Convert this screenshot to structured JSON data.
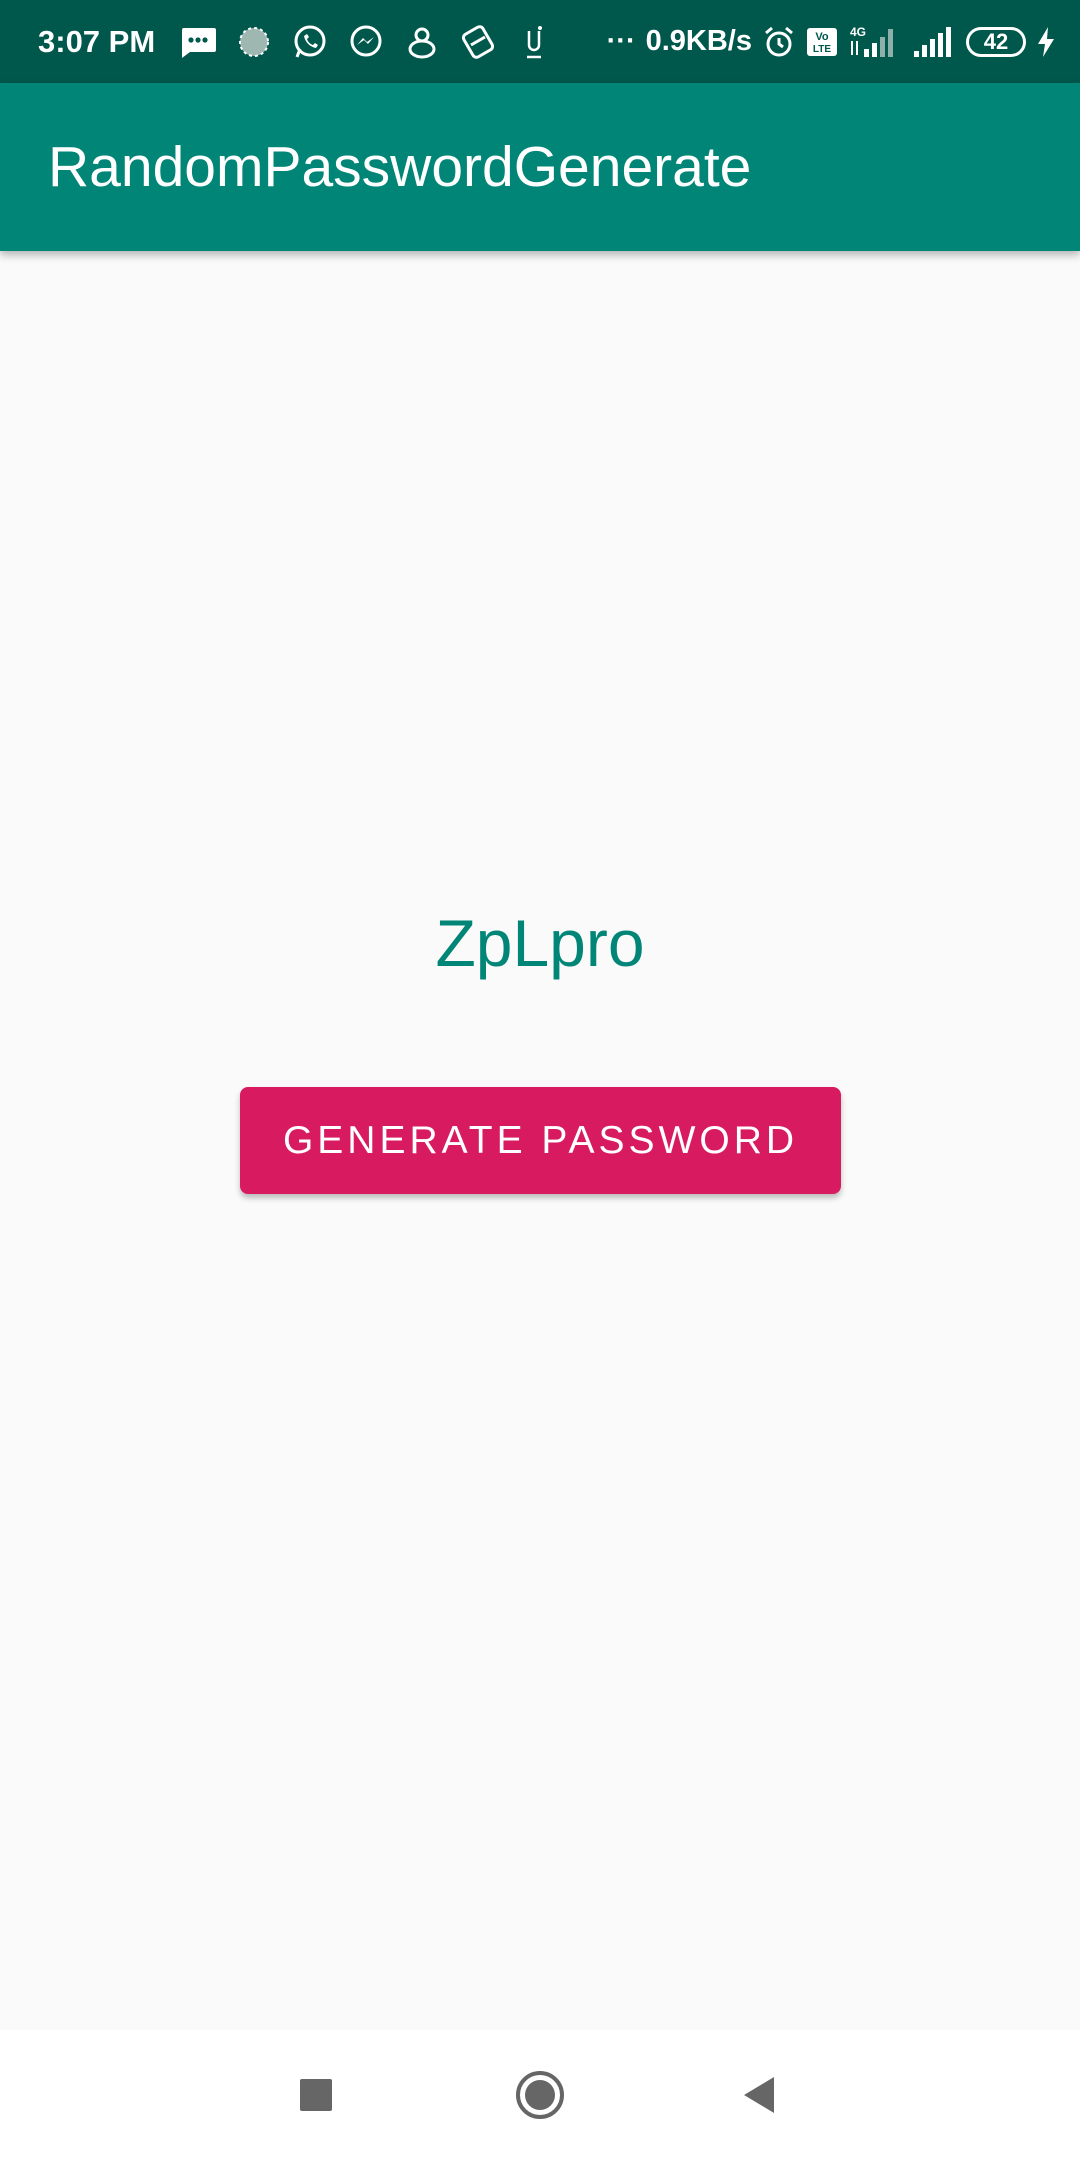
{
  "status_bar": {
    "time": "3:07 PM",
    "dots": "···",
    "net_speed": "0.9KB/s",
    "battery_level": "42",
    "icons_left": [
      "messages-icon",
      "sync-icon",
      "whatsapp-icon",
      "messenger-icon",
      "app-icon",
      "shield-icon",
      "notification-icon"
    ],
    "icons_right": [
      "alarm-icon",
      "volte-icon",
      "4g-signal-icon",
      "signal-icon",
      "battery-icon",
      "charging-icon"
    ],
    "background": "#00574b"
  },
  "app_bar": {
    "title": "RandomPasswordGenerate",
    "background": "#008577"
  },
  "main": {
    "password": "ZpLpro",
    "generate_button_label": "GENERATE PASSWORD",
    "button_color": "#d81b60",
    "text_color": "#008577"
  },
  "nav_bar": {
    "buttons": [
      "recent-apps-icon",
      "home-icon",
      "back-icon"
    ]
  }
}
